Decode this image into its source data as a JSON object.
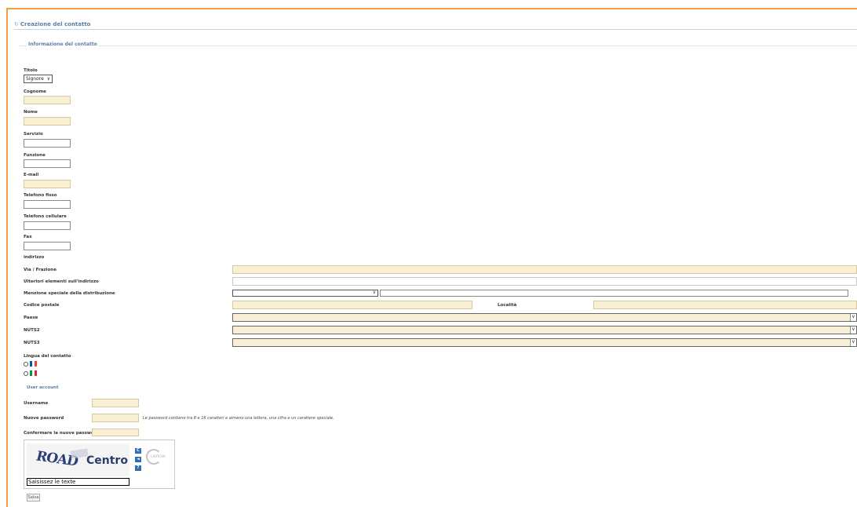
{
  "header": {
    "title": "Creazione del contatto",
    "bullet": "↻"
  },
  "section_contact": {
    "legend": "Informazione del contatto"
  },
  "fields": {
    "titolo": {
      "label": "Titolo",
      "value": "Signore"
    },
    "cognome": {
      "label": "Cognome",
      "value": ""
    },
    "nome": {
      "label": "Nome",
      "value": ""
    },
    "servizio": {
      "label": "Servizio",
      "value": ""
    },
    "funzione": {
      "label": "Funzione",
      "value": ""
    },
    "email": {
      "label": "E-mail",
      "value": ""
    },
    "telefono_fisso": {
      "label": "Telefono fisso",
      "value": ""
    },
    "telefono_cellulare": {
      "label": "Telefono cellulare",
      "value": ""
    },
    "fax": {
      "label": "Fax",
      "value": ""
    }
  },
  "address": {
    "heading": "indirizzo",
    "via_label": "Via / Frazione",
    "ulteriori_label": "Ulteriori elementi sull'indirizzo",
    "menzione_label": "Menzione speciale della distribuzione",
    "codice_label": "Codice postale",
    "localita_label": "Località",
    "paese_label": "Paese",
    "nuts2_label": "NUTS2",
    "nuts3_label": "NUTS3"
  },
  "language": {
    "label": "Lingua del contatto",
    "options": [
      {
        "name": "french",
        "colors": [
          "#0055a4",
          "#ffffff",
          "#ef4135"
        ]
      },
      {
        "name": "italian",
        "colors": [
          "#009246",
          "#ffffff",
          "#ce2b37"
        ]
      }
    ]
  },
  "account": {
    "heading": "User account",
    "username_label": "Username",
    "password_label": "Nuove password",
    "password_hint": "Le password contiene tra 8 e 16 caratteri e almeno una lettera, una cifra e un carattere speciale.",
    "confirm_label": "Confermare la nuove password"
  },
  "captcha": {
    "word1": "ROAD",
    "word2": "Centro",
    "btn_refresh": "C",
    "btn_audio": "◄",
    "btn_help": "?",
    "logo_text": "CAPTCHA",
    "input_value": "Saisissez le texte"
  },
  "buttons": {
    "save": "Salva"
  }
}
